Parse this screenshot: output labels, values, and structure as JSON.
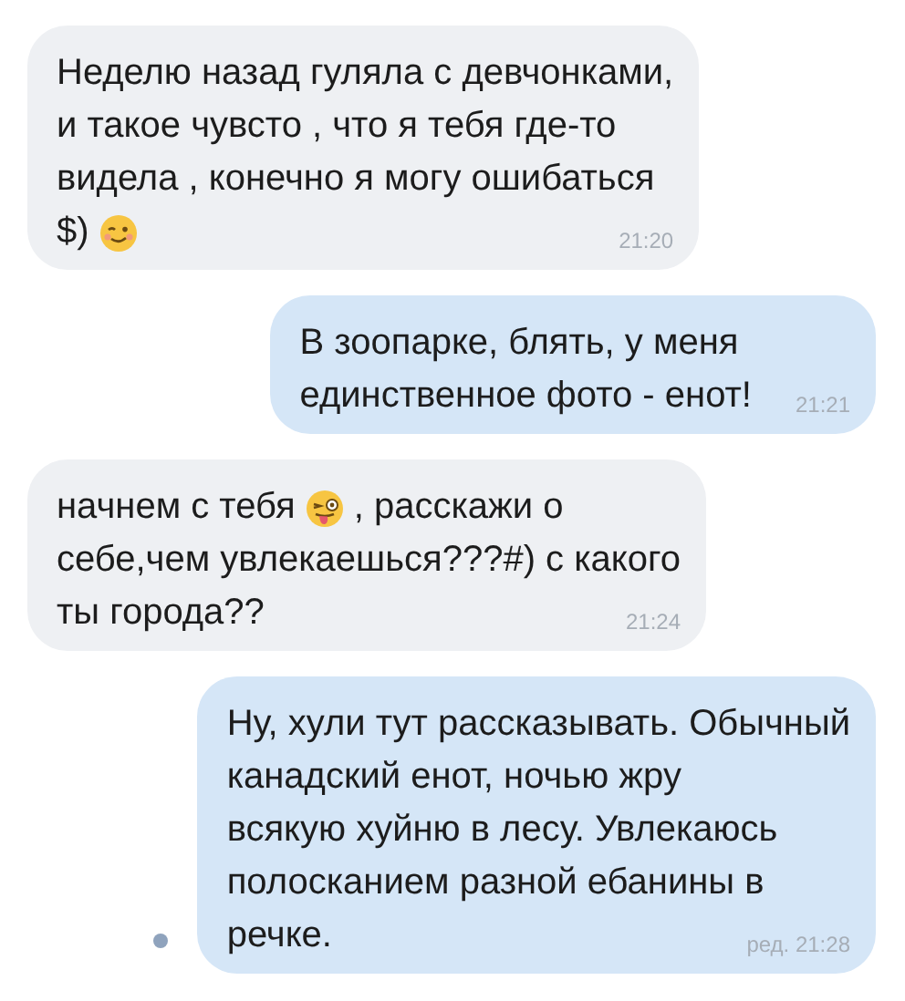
{
  "messages": [
    {
      "outgoing": false,
      "unread": false,
      "lines": [
        [
          {
            "kind": "text",
            "text": "Неделю назад гуляла с девчонками,"
          }
        ],
        [
          {
            "kind": "text",
            "text": "и такое чувсто , что я тебя где-то"
          }
        ],
        [
          {
            "kind": "text",
            "text": "видела , конечно я могу ошибаться"
          }
        ],
        [
          {
            "kind": "text",
            "text": "$)"
          },
          {
            "kind": "wink"
          }
        ]
      ],
      "time": "21:20"
    },
    {
      "outgoing": true,
      "unread": false,
      "lines": [
        [
          {
            "kind": "text",
            "text": "В зоопарке, блять, у меня"
          }
        ],
        [
          {
            "kind": "text",
            "text": "единственное фото - енот!"
          }
        ]
      ],
      "time": "21:21"
    },
    {
      "outgoing": false,
      "unread": false,
      "lines": [
        [
          {
            "kind": "text",
            "text": "начнем с тебя"
          },
          {
            "kind": "tongue"
          },
          {
            "kind": "text",
            "text": ", расскажи о"
          }
        ],
        [
          {
            "kind": "text",
            "text": "себе,чем увлекаешься???#) с какого"
          }
        ],
        [
          {
            "kind": "text",
            "text": "ты города??"
          }
        ]
      ],
      "time": "21:24"
    },
    {
      "outgoing": true,
      "unread": true,
      "lines": [
        [
          {
            "kind": "text",
            "text": "Ну, хули тут рассказывать. Обычный"
          }
        ],
        [
          {
            "kind": "text",
            "text": "канадский енот, ночью жру"
          }
        ],
        [
          {
            "kind": "text",
            "text": "всякую хуйню в лесу. Увлекаюсь"
          }
        ],
        [
          {
            "kind": "text",
            "text": "полосканием разной ебанины в"
          }
        ],
        [
          {
            "kind": "text",
            "text": "речке."
          }
        ]
      ],
      "time": "ред. 21:28"
    }
  ]
}
